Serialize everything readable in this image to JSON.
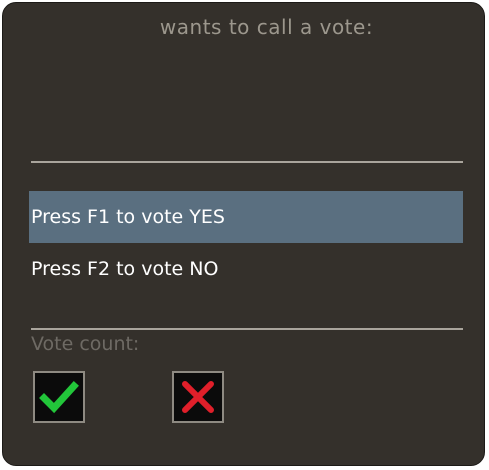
{
  "vote_dialog": {
    "title": "wants to call a vote:",
    "options": [
      {
        "label": "Press F1 to vote YES",
        "selected": true
      },
      {
        "label": "Press F2 to vote NO",
        "selected": false
      }
    ],
    "vote_count_label": "Vote count:",
    "icons": {
      "yes": "check-icon",
      "no": "cross-icon"
    },
    "colors": {
      "background": "#34302b",
      "selected_row": "#5a6f80",
      "check": "#22c63a",
      "cross": "#e01f2a"
    }
  }
}
